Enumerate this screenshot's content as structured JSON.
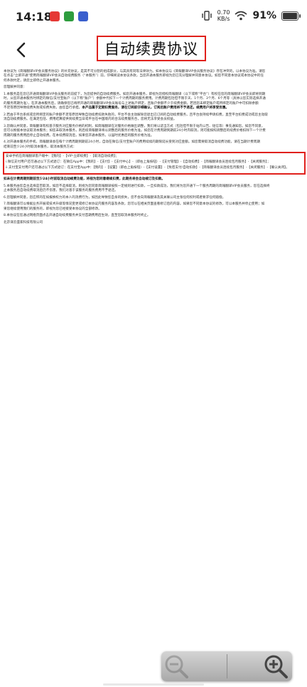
{
  "status_bar": {
    "time": "14:18",
    "net_speed_value": "0.70",
    "net_speed_unit": "KB/s",
    "battery": "91%",
    "battery_level": 0.91
  },
  "nav": {
    "title": "自动续费协议"
  },
  "document": {
    "intro": [
      "本协议为《简報翻译VIP会员服务协议》的补充协议，是其不可分割的组成部分，与其具有同等法律效力。如本协议与《简報翻译VIP会员服务协议》存在冲突的，以本协议为准。请您",
      "在点击“立即开通”使用简報翻译VIP会员自动续费服务（“本服务”）前，仔细阅读本协议条款，当您开通本服务即视为您已充分理解并同意本协议。如您不同意本协议或本协议中的任",
      "何条款约定，请您立即停止开通本服务。"
    ],
    "special_notice": "您理解并同意：",
    "clause1": [
      "1.本服务是在您已开通简報翻译VIP会员服务的前提下，为您提供的自动续费服务。如您开通本服务，即视为您授权简報翻译（以下或称“平台”）有权在您的简報翻译VIP会员即将到期",
      "时，从您开通本服务时绑定的微信/支付宝账户（以下称“账户”）余额中代扣下一个计费周期的服务费用。计费周期包括但不限于天、1个月、3个月、6个月等（具体以您实际选择开通",
      "的服务周期为准），在开通本服务后，请确保您已将所开通的简報翻译VIP会员账号与上述账户绑定，且账户余额不少于续费金额，若因您未绑定账户或所绑定的账户中可扣除余额",
      "不足等原因导致续费失败或扣费失败，由您自行承担。"
    ],
    "clause1_bold": "本产品属于定期扣费服务，请在订阅前仔细确认，订阅后账户费用将不予退还。",
    "clause1_bold2": "续费用户将享受优惠。",
    "clause2": [
      "2.若由于平台系统或您所绑定的账户余额不足等原因导致自动续费扣款失败的，平台不会主动解除您退出已订阅的自动续费服务，且平台会持续申请扣费，直至平台扣费成功或您主动取",
      "消自动续费服务。在满足包括、费用结算提供到续费当日或平台在中国境内的合法续费服务合，您将无法享受会员权益。"
    ],
    "clause3": [
      "3.您确认并同意，简報翻译有权基于服务对应服务价格的机制，如简報翻译在对服务价格做出调整，我们将以适当方式（包括但不限于站内公告、短信等）事先通知您。如您不同意，",
      "您可以根据本协议取消本服务；如您未取消本服务，则后续简報翻译将以调整后的服务价格为准。如您在计费周期到期前24小时内取消，则可能按照调整后的续费价格扣除下一个计费",
      "周期的服务费用后停止自动续费。在本续费取消后，如果您开通本服务，以届时优惠后的服务价格为准。"
    ],
    "clause4": [
      "4.对开通本服务的手机、简報翻译会在每个计费周期到期前24小时，自动在微信/支付宝账户的费用续续的期限延长受到对应金额。如您需要取消自动续费功能，请在当期计费周期",
      "结束前至少24小时取消本服务，取消本服务方式："
    ],
    "cancel_methods": [
      "安卓手机在简報翻译客户端中：【我的】-【VIP·立即续费】-【取消自动续费】；",
      "i.微信支付用户还可通过以下方式退订：在微信App中：【我的】-【支付】-【支付中心】-（即右上角按钮）-【支付管理】-【自动扣费】-【简報翻译会员连续包月服务】-【关闭服务】；",
      "ii.支付宝支付用户还可通过以下方式退订：在支付宝App中：【我的】-【设置】（即右上角按钮）-【支付设置】-【免密支付/自动扣款】-【简報翻译会员连续包月服务】-【关闭服务】-【确认关闭】。"
    ],
    "bold_notice": "如未在计费周期到期前至少24小时前取消自动续费功能，将视为您同意继续扣费，此期务将会自动续订及扣款。",
    "clause5": [
      "5.本服务由您自主选择是否取消，如您不选择取消，则视为您同意简報翻译按照一定规则进行扣款，一旦扣款成功，我们将为您开通下一个服务周期的简報翻译VIP会员服务，您在选择终",
      "止本服务后自动续费取消后仍不伤害，我们对基于该服务的服务费用不予退还。"
    ],
    "clause6": "6.您理解并同意，您应积的在如报换权力的本人的消费行为，如因此导致您自身的损失，您不会向简報翻译及其关联公司主张任何权利或者要求任何赔偿。",
    "clause7": [
      "7.简報翻译可以根据业务开展或技术升级等情况变更或修订本协议内服务内容及条款，您可以在相关页面查看修订后的内容。如果您不同意本协议的修改，可以本服务并停止使用；如",
      "果您继续使用我们的服务的，即视为您已经接受本协议的全部修改。"
    ],
    "clause8": "8.本协议在您通过网络页面点击开通自动续费服务并支付首期费用后生效，直至您取消本服务时终止。",
    "company": "北京译云盛家科技有限公司"
  },
  "zoom": {
    "zoom_out_icon": "zoom-out-icon",
    "zoom_in_icon": "zoom-in-icon"
  },
  "colors": {
    "highlight_border": "#e0201c",
    "app_badge_1": "#e53935",
    "app_badge_2": "#2e9d3e",
    "app_badge_3": "#3a5fcd"
  }
}
